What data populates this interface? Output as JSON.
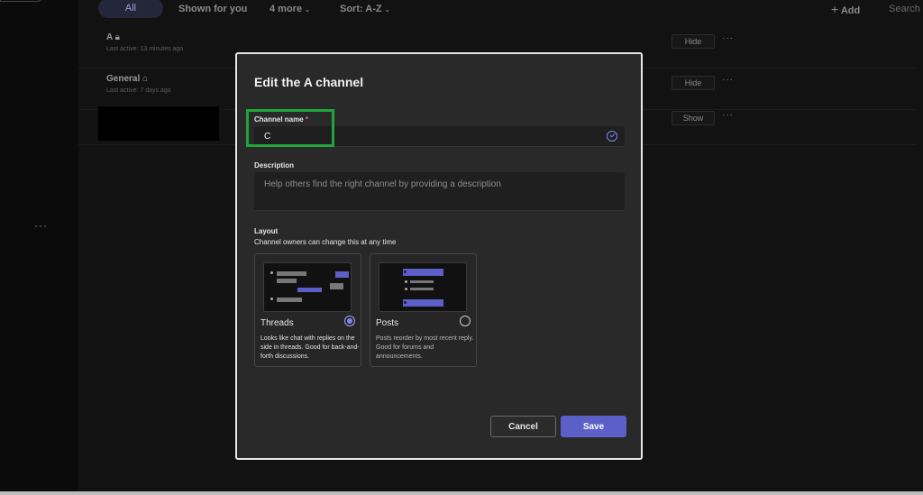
{
  "filters": {
    "all": "All",
    "shown_for_you": "Shown for you",
    "more": "4 more",
    "sort": "Sort: A-Z",
    "add": "Add",
    "search": "Search"
  },
  "channels": [
    {
      "name": "A",
      "sub": "Last active: 13 minutes ago",
      "action": "Hide",
      "icon": "lock-icon"
    },
    {
      "name": "General",
      "sub": "Last active: 7 days ago",
      "action": "Hide",
      "icon": "home-icon"
    },
    {
      "name": "",
      "sub": "",
      "action": "Show",
      "icon": ""
    }
  ],
  "dialog": {
    "title": "Edit the A channel",
    "channel_name_label": "Channel name",
    "required_mark": "*",
    "channel_name_value": "C",
    "description_label": "Description",
    "description_placeholder": "Help others find the right channel by providing a description",
    "layout_label": "Layout",
    "layout_sub": "Channel owners can change this at any time",
    "layouts": [
      {
        "title": "Threads",
        "desc": "Looks like chat with replies on the side in threads. Good for back-and-forth discussions.",
        "selected": true
      },
      {
        "title": "Posts",
        "desc": "Posts reorder by most recent reply. Good for forums and announcements.",
        "selected": false
      }
    ],
    "cancel": "Cancel",
    "save": "Save"
  },
  "colors": {
    "accent": "#5b5fc7",
    "highlight": "#1fa53b"
  },
  "rail": {
    "more": "···"
  }
}
